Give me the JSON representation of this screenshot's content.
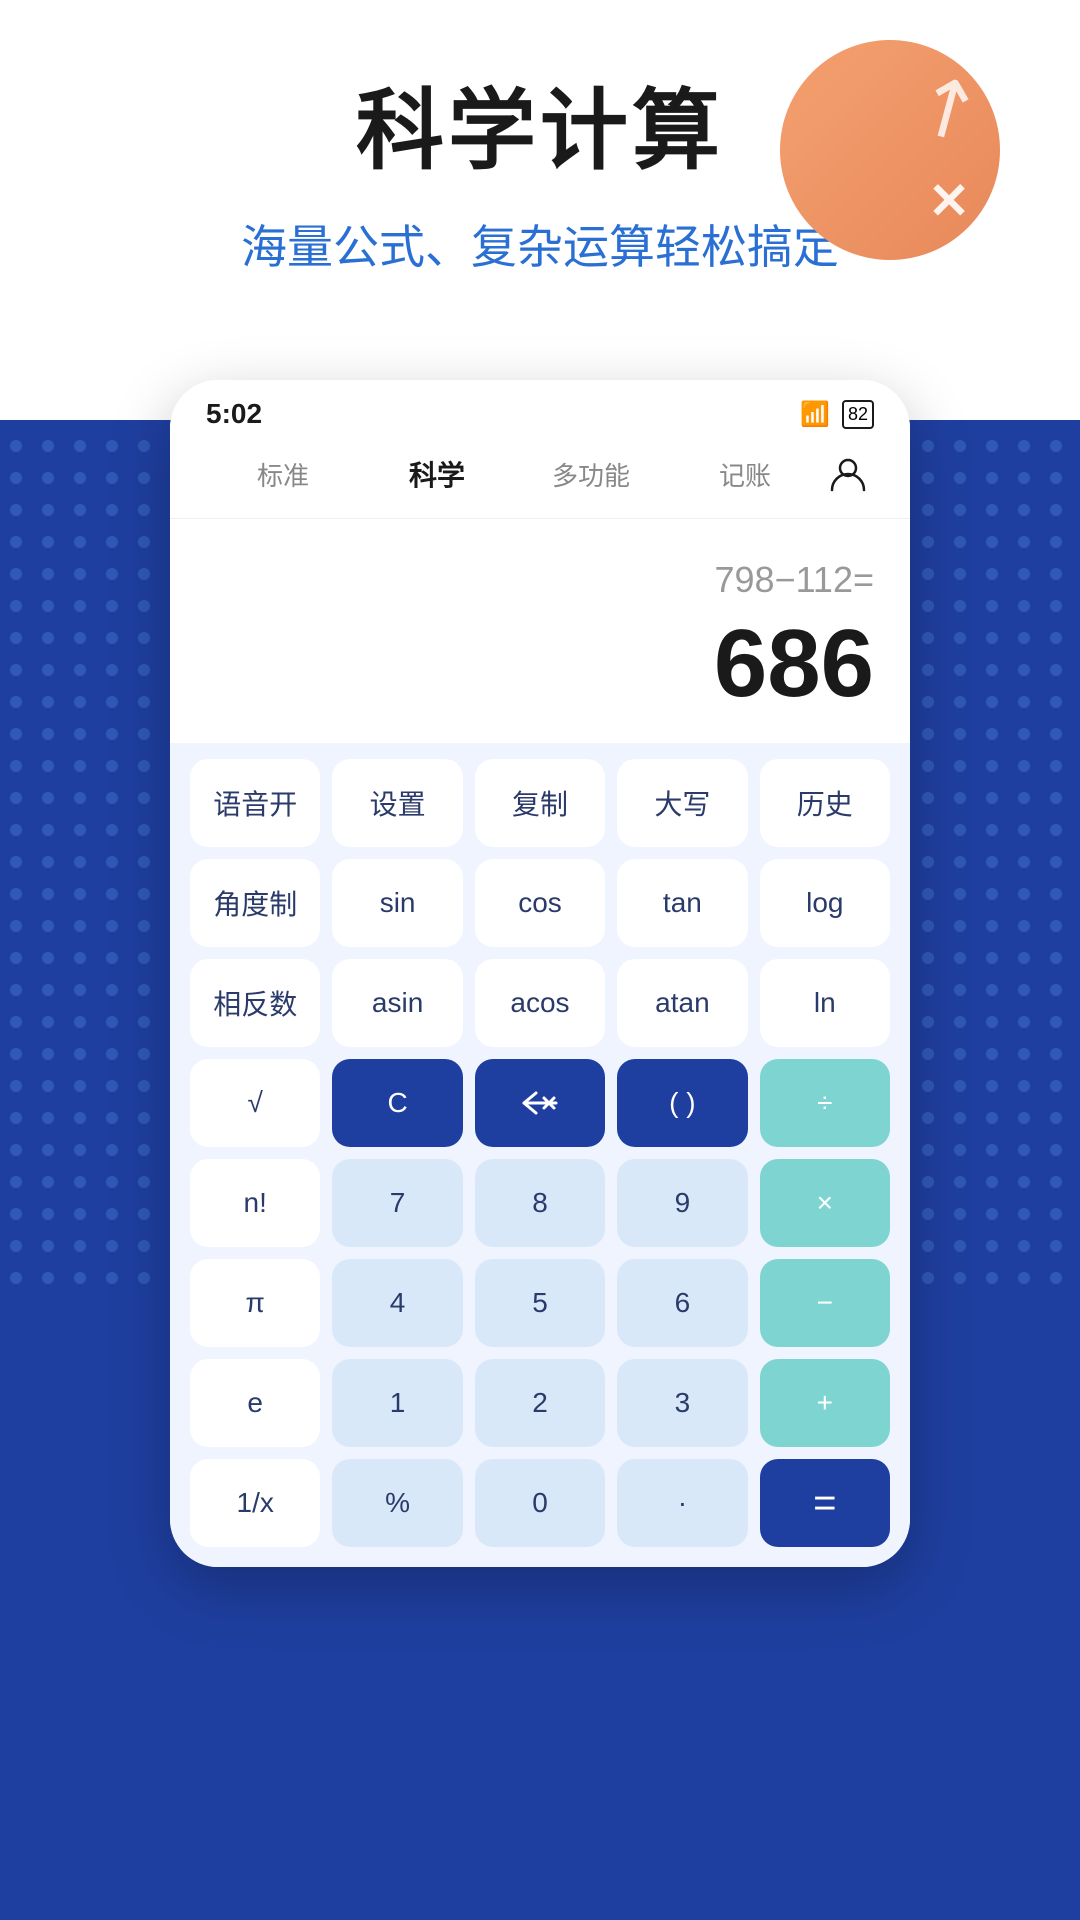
{
  "page": {
    "title": "科学计算",
    "subtitle": "海量公式、复杂运算轻松搞定"
  },
  "status_bar": {
    "time": "5:02",
    "battery": "82"
  },
  "tabs": [
    {
      "label": "标准",
      "active": false
    },
    {
      "label": "科学",
      "active": true
    },
    {
      "label": "多功能",
      "active": false
    },
    {
      "label": "记账",
      "active": false
    }
  ],
  "display": {
    "expression": "798−112=",
    "result": "686"
  },
  "buttons_row1": [
    {
      "label": "语音开",
      "style": "white"
    },
    {
      "label": "设置",
      "style": "white"
    },
    {
      "label": "复制",
      "style": "white"
    },
    {
      "label": "大写",
      "style": "white"
    },
    {
      "label": "历史",
      "style": "white"
    }
  ],
  "buttons_row2": [
    {
      "label": "角度制",
      "style": "white"
    },
    {
      "label": "sin",
      "style": "white"
    },
    {
      "label": "cos",
      "style": "white"
    },
    {
      "label": "tan",
      "style": "white"
    },
    {
      "label": "log",
      "style": "white"
    }
  ],
  "buttons_row3": [
    {
      "label": "相反数",
      "style": "white"
    },
    {
      "label": "asin",
      "style": "white"
    },
    {
      "label": "acos",
      "style": "white"
    },
    {
      "label": "atan",
      "style": "white"
    },
    {
      "label": "ln",
      "style": "white"
    }
  ],
  "buttons_row4": [
    {
      "label": "√",
      "style": "white"
    },
    {
      "label": "C",
      "style": "dark-blue"
    },
    {
      "label": "⌫",
      "style": "dark-blue"
    },
    {
      "label": "( )",
      "style": "dark-blue"
    },
    {
      "label": "÷",
      "style": "teal"
    }
  ],
  "buttons_row5": [
    {
      "label": "n!",
      "style": "white"
    },
    {
      "label": "7",
      "style": "light"
    },
    {
      "label": "8",
      "style": "light"
    },
    {
      "label": "9",
      "style": "light"
    },
    {
      "label": "×",
      "style": "teal"
    }
  ],
  "buttons_row6": [
    {
      "label": "π",
      "style": "white"
    },
    {
      "label": "4",
      "style": "light"
    },
    {
      "label": "5",
      "style": "light"
    },
    {
      "label": "6",
      "style": "light"
    },
    {
      "label": "−",
      "style": "teal"
    }
  ],
  "buttons_row7": [
    {
      "label": "e",
      "style": "white"
    },
    {
      "label": "1",
      "style": "light"
    },
    {
      "label": "2",
      "style": "light"
    },
    {
      "label": "3",
      "style": "light"
    },
    {
      "label": "+",
      "style": "teal"
    }
  ],
  "buttons_row8": [
    {
      "label": "1/x",
      "style": "white"
    },
    {
      "label": "%",
      "style": "light"
    },
    {
      "label": "0",
      "style": "light"
    },
    {
      "label": "·",
      "style": "light"
    },
    {
      "label": "=",
      "style": "dark-blue-wide"
    }
  ]
}
